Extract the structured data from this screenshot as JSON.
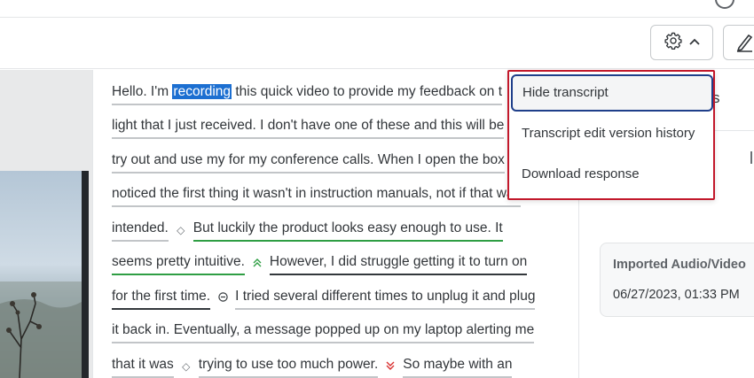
{
  "transcript": {
    "lines": [
      {
        "segments": [
          {
            "before": "Hello. I'm ",
            "highlight": "recording",
            "after": " this quick video to provide my feedback on t"
          }
        ]
      },
      {
        "segments": [
          {
            "text": "light that I just received. I don't have one of these and this will be"
          }
        ]
      },
      {
        "segments": [
          {
            "text": "try out and use my for my conference calls. When I open the box"
          }
        ]
      },
      {
        "segments": [
          {
            "text": "noticed the first thing it wasn't in instruction manuals, not if that was"
          }
        ]
      },
      {
        "segments": [
          {
            "text": "intended."
          },
          {
            "text": "But luckily the product looks easy enough to use. It"
          }
        ]
      },
      {
        "segments": [
          {
            "text": "seems pretty intuitive."
          },
          {
            "text": "However, I did struggle getting it to turn on"
          }
        ]
      },
      {
        "segments": [
          {
            "text": "for the first time."
          },
          {
            "text": "I tried several different times to unplug it and plug"
          }
        ]
      },
      {
        "segments": [
          {
            "text": "it back in. Eventually, a message popped up on my laptop alerting me"
          }
        ]
      },
      {
        "segments": [
          {
            "text": "that it was"
          },
          {
            "text": "trying to use too much power."
          },
          {
            "text": "So maybe with an"
          }
        ]
      }
    ]
  },
  "menu": {
    "items": [
      {
        "label": "Hide transcript"
      },
      {
        "label": "Transcript edit version history"
      },
      {
        "label": "Download response"
      }
    ]
  },
  "right_panel": {
    "header_fragment": "s",
    "card": {
      "title": "Imported Audio/Video",
      "date": "06/27/2023, 01:33 PM"
    }
  },
  "icons": {
    "settings": "gear-icon",
    "settings_caret": "chevron-up-icon",
    "edit": "pen-icon",
    "sentiment_neutral": "diamond-icon",
    "sentiment_positive": "double-chevron-up-icon",
    "sentiment_mixed": "minus-circle-icon",
    "sentiment_negative": "double-chevron-down-icon"
  },
  "colors": {
    "highlight": "#1c6fd1",
    "positive": "#2f9e44",
    "negative": "#d93030",
    "dropdown_border": "#c2182b",
    "focus_border": "#1f3f8a"
  }
}
